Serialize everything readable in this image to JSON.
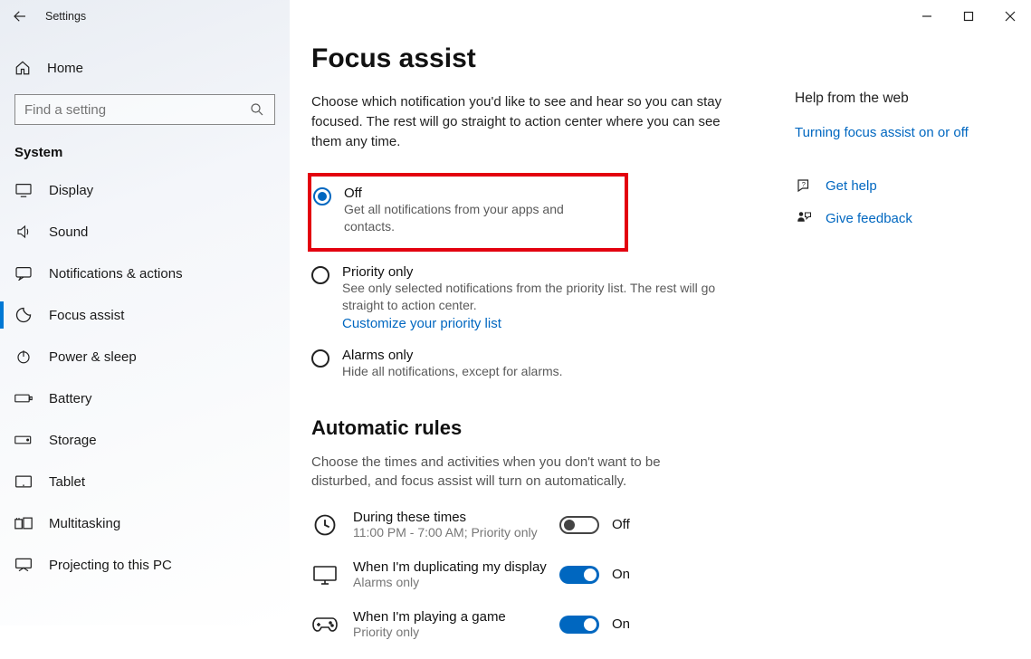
{
  "window": {
    "title": "Settings"
  },
  "sidebar": {
    "home": "Home",
    "search_placeholder": "Find a setting",
    "section": "System",
    "items": [
      {
        "label": "Display"
      },
      {
        "label": "Sound"
      },
      {
        "label": "Notifications & actions"
      },
      {
        "label": "Focus assist"
      },
      {
        "label": "Power & sleep"
      },
      {
        "label": "Battery"
      },
      {
        "label": "Storage"
      },
      {
        "label": "Tablet"
      },
      {
        "label": "Multitasking"
      },
      {
        "label": "Projecting to this PC"
      }
    ]
  },
  "main": {
    "title": "Focus assist",
    "description": "Choose which notification you'd like to see and hear so you can stay focused. The rest will go straight to action center where you can see them any time.",
    "radios": {
      "off": {
        "title": "Off",
        "sub": "Get all notifications from your apps and contacts."
      },
      "priority": {
        "title": "Priority only",
        "sub": "See only selected notifications from the priority list. The rest will go straight to action center.",
        "link": "Customize your priority list"
      },
      "alarms": {
        "title": "Alarms only",
        "sub": "Hide all notifications, except for alarms."
      }
    },
    "rules_heading": "Automatic rules",
    "rules_description": "Choose the times and activities when you don't want to be disturbed, and focus assist will turn on automatically.",
    "rules": {
      "times": {
        "title": "During these times",
        "sub": "11:00 PM - 7:00 AM; Priority only",
        "state": "Off"
      },
      "duplicate": {
        "title": "When I'm duplicating my display",
        "sub": "Alarms only",
        "state": "On"
      },
      "game": {
        "title": "When I'm playing a game",
        "sub": "Priority only",
        "state": "On"
      }
    }
  },
  "right": {
    "heading": "Help from the web",
    "link1": "Turning focus assist on or off",
    "help": "Get help",
    "feedback": "Give feedback"
  }
}
